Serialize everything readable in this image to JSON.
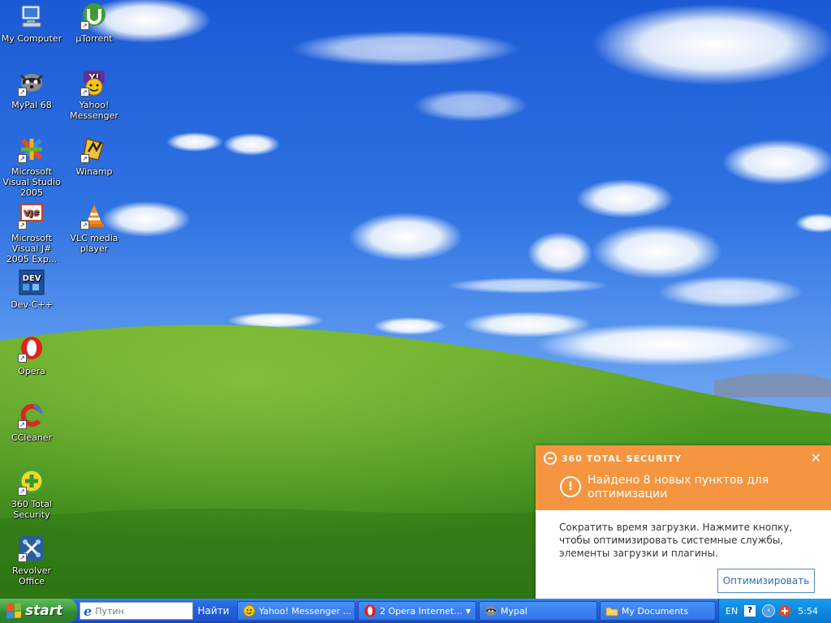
{
  "desktop": {
    "icons": [
      {
        "label": "My Computer",
        "icon": "my-computer-icon"
      },
      {
        "label": "µTorrent",
        "icon": "utorrent-icon"
      },
      {
        "label": "MyPal 68",
        "icon": "mypal-icon"
      },
      {
        "label": "Yahoo! Messenger",
        "icon": "yahoo-messenger-icon"
      },
      {
        "label": "Microsoft Visual Studio 2005",
        "icon": "visual-studio-icon"
      },
      {
        "label": "Winamp",
        "icon": "winamp-icon"
      },
      {
        "label": "Microsoft Visual J# 2005 Exp...",
        "icon": "visual-jsharp-icon"
      },
      {
        "label": "VLC media player",
        "icon": "vlc-icon"
      },
      {
        "label": "Dev-C++",
        "icon": "devcpp-icon"
      },
      {
        "label": "Opera",
        "icon": "opera-icon"
      },
      {
        "label": "CCleaner",
        "icon": "ccleaner-icon"
      },
      {
        "label": "360 Total Security",
        "icon": "360-total-security-icon"
      },
      {
        "label": "Revolver Office",
        "icon": "revolver-office-icon"
      }
    ]
  },
  "popup": {
    "brand": "360 TOTAL SECURITY",
    "close": "✕",
    "alert_glyph": "!",
    "title": "Найдено 8 новых пунктов для оптимизации",
    "body": "Сократить время загрузки. Нажмите кнопку, чтобы оптимизировать системные службы, элементы загрузки и плагины.",
    "button": "Оптимизировать",
    "colors": {
      "header": "#f5953f",
      "button_border": "#4d8ec2"
    }
  },
  "taskbar": {
    "start_label": "start",
    "search_placeholder": "Путин",
    "go_label": "Найти",
    "tasks": [
      {
        "label": "Yahoo! Messenger ...",
        "icon": "yahoo-messenger-icon"
      },
      {
        "label": "2 Opera Internet...",
        "icon": "opera-icon"
      },
      {
        "label": "Mypal",
        "icon": "mypal-icon"
      },
      {
        "label": "My Documents",
        "icon": "folder-icon"
      }
    ],
    "tray": {
      "language": "EN",
      "help": "?",
      "expand": "‹",
      "clock": "5:54"
    }
  }
}
